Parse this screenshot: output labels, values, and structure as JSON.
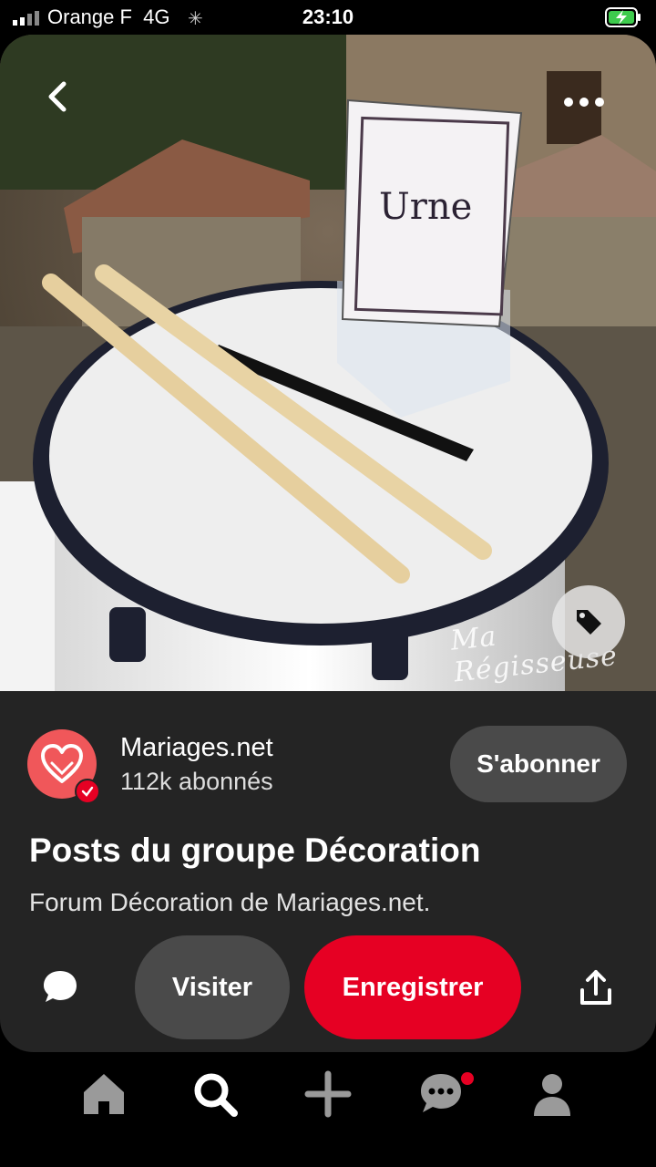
{
  "status_bar": {
    "carrier": "Orange F",
    "network": "4G",
    "time": "23:10"
  },
  "pin": {
    "sign_text": "Urne",
    "watermark": "Ma Régisseuse"
  },
  "source": {
    "name": "Mariages.net",
    "followers": "112k abonnés",
    "follow_label": "S'abonner"
  },
  "post": {
    "title": "Posts du groupe Décoration",
    "description": "Forum Décoration de Mariages.net."
  },
  "actions": {
    "visit_label": "Visiter",
    "save_label": "Enregistrer"
  },
  "nav": {
    "items": [
      "home-icon",
      "search-icon",
      "plus-icon",
      "chat-icon",
      "profile-icon"
    ],
    "active": "search-icon",
    "badge_on": "chat-icon"
  },
  "colors": {
    "brand_red": "#e60023",
    "card_bg": "#242424",
    "button_grey": "#4a4a4a"
  }
}
